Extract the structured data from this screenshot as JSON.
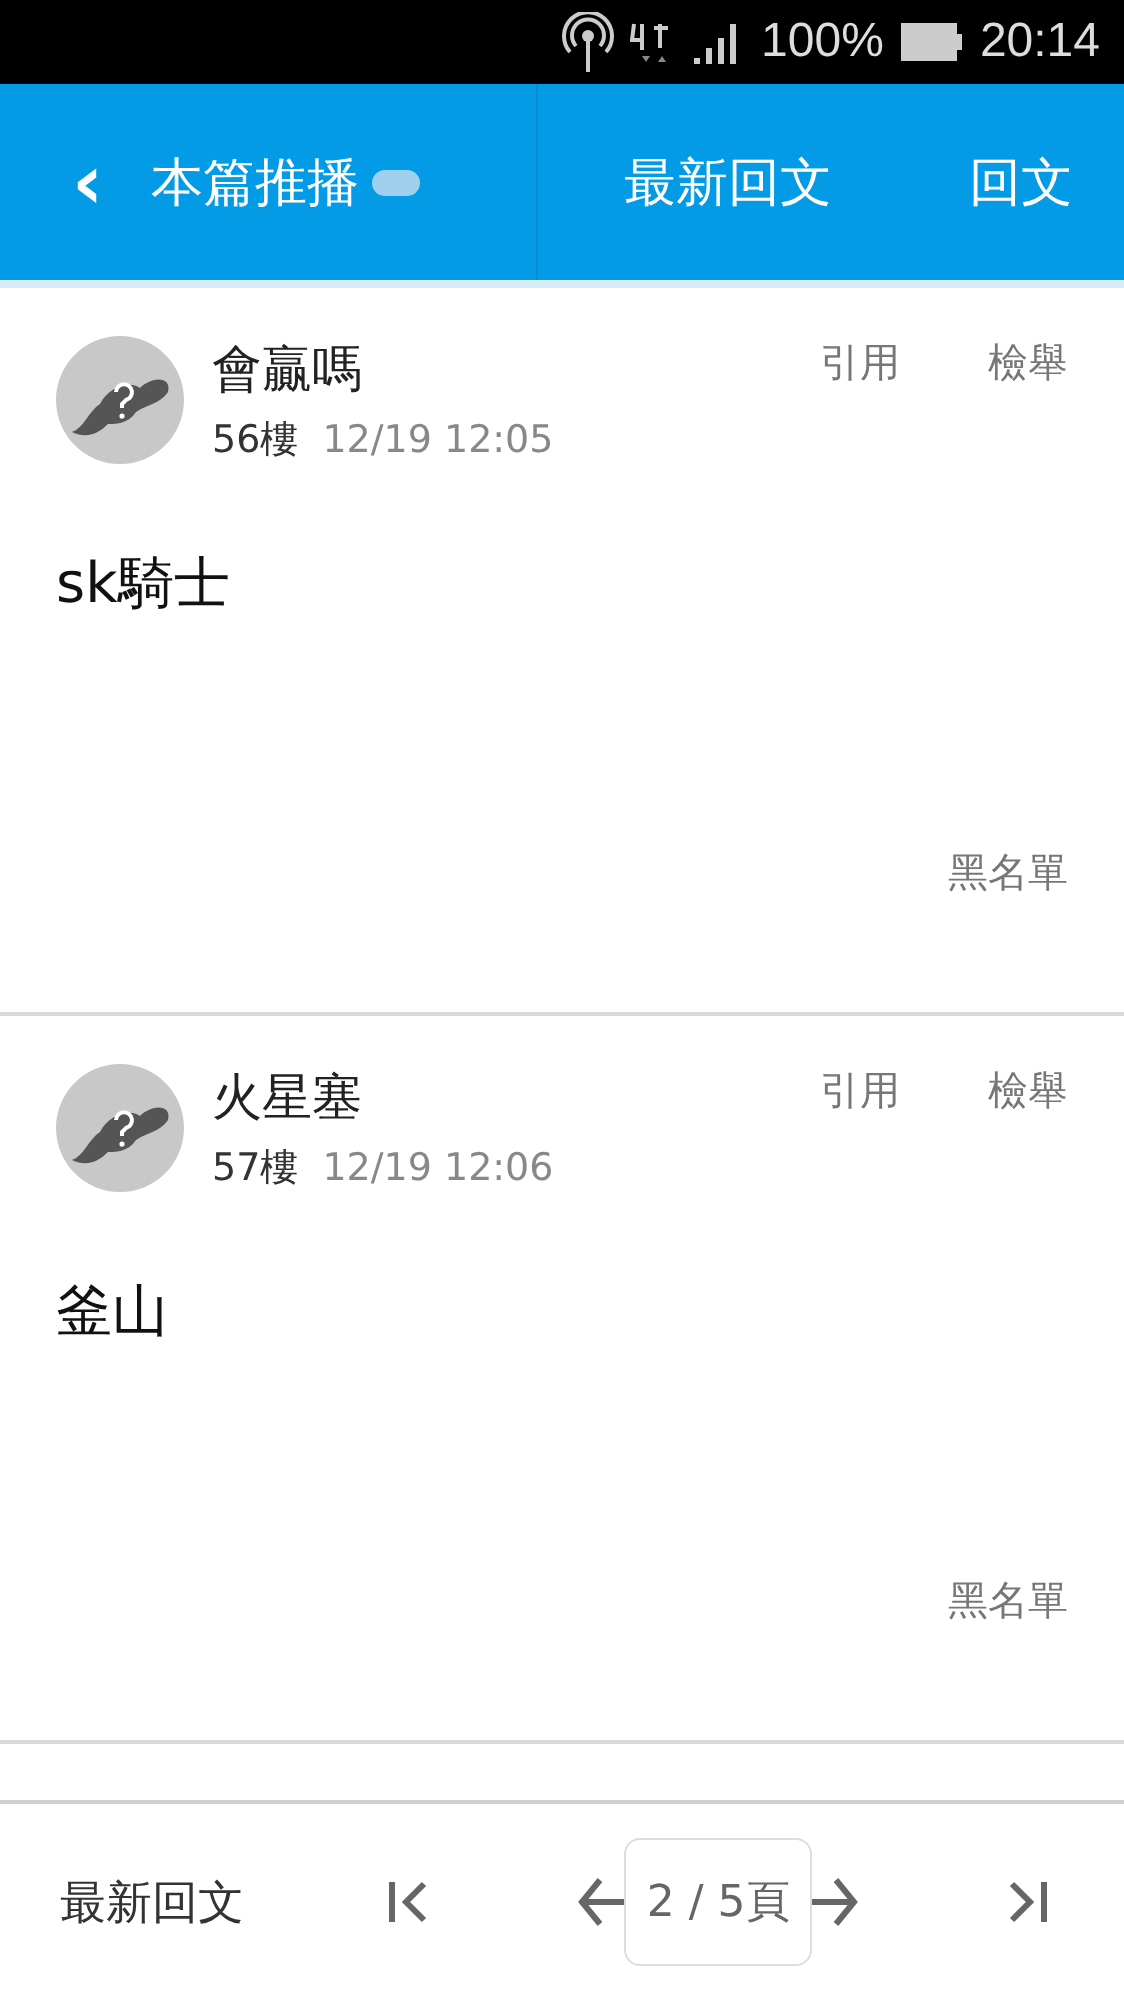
{
  "status_bar": {
    "battery": "100%",
    "time": "20:14"
  },
  "header": {
    "back": "‹",
    "tabs": [
      {
        "label": "本篇推播",
        "kind": "toggle",
        "on": true
      },
      {
        "label": "最新回文",
        "kind": "plain"
      },
      {
        "label": "回文",
        "kind": "plain"
      }
    ]
  },
  "posts": [
    {
      "author": "會贏嗎",
      "floor": "56樓",
      "time": "12/19 12:05",
      "body": "sk騎士",
      "quote": "引用",
      "report": "檢舉",
      "blacklist": "黑名單"
    },
    {
      "author": "火星塞",
      "floor": "57樓",
      "time": "12/19 12:06",
      "body": "釜山",
      "quote": "引用",
      "report": "檢舉",
      "blacklist": "黑名單"
    }
  ],
  "bottom_bar": {
    "latest": "最新回文",
    "page": "2 / 5頁"
  }
}
